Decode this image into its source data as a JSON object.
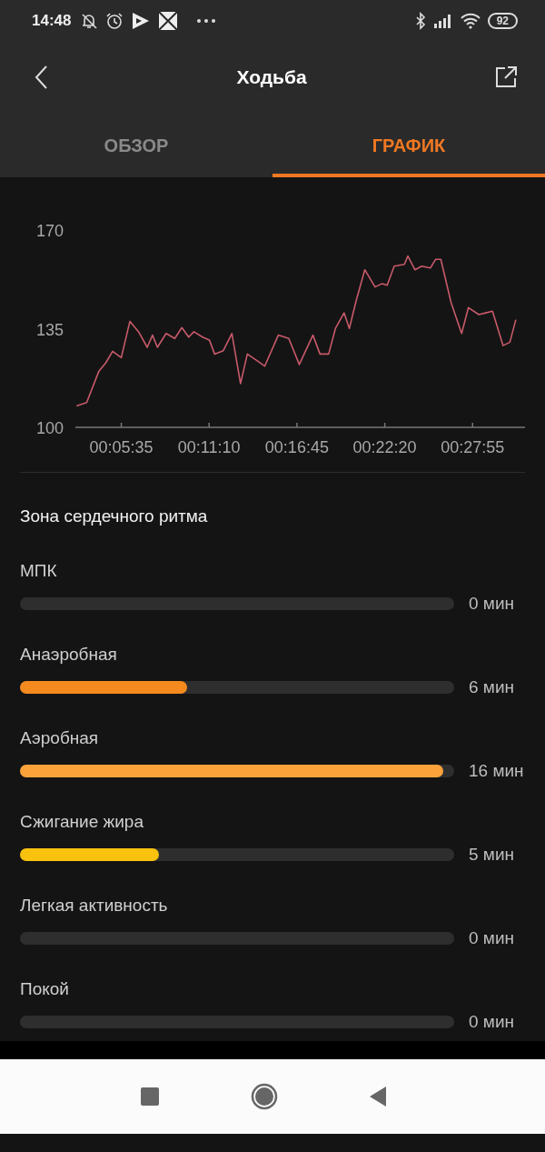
{
  "status_bar": {
    "time": "14:48",
    "battery": "92"
  },
  "header": {
    "title": "Ходьба"
  },
  "tabs": [
    {
      "label": "ОБЗОР",
      "selected": false
    },
    {
      "label": "ГРАФИК",
      "selected": true
    }
  ],
  "chart": {
    "chart_data": {
      "type": "line",
      "x": [
        164,
        203,
        249,
        276,
        302,
        335,
        368,
        401,
        434,
        454,
        473,
        506,
        539,
        566,
        592,
        612,
        645,
        671,
        691,
        724,
        757,
        790,
        816,
        855,
        882,
        934,
        974,
        1014,
        1066,
        1093,
        1126,
        1152,
        1185,
        1205,
        1231,
        1264,
        1303,
        1330,
        1349,
        1376,
        1415,
        1428,
        1455,
        1481,
        1514,
        1534,
        1554,
        1593,
        1633,
        1659,
        1699,
        1725,
        1751,
        1791,
        1817,
        1840
      ],
      "series": [
        {
          "color": "#c85a6a",
          "values": [
            107.6,
            108.8,
            119.8,
            122.9,
            127,
            124.7,
            137.6,
            133.9,
            128.4,
            132.7,
            128.4,
            133.3,
            131.5,
            135.4,
            132,
            133.9,
            132,
            131,
            126,
            127.2,
            133.3,
            115.5,
            126,
            123.5,
            121.7,
            132.7,
            131.5,
            122.3,
            132.7,
            126,
            126,
            135.1,
            140.6,
            135.1,
            144.9,
            155.9,
            149.8,
            151,
            150.4,
            157.2,
            157.8,
            160.8,
            155.9,
            157.2,
            156.5,
            159.6,
            159.6,
            144.3,
            133.3,
            142.5,
            140,
            140.6,
            141.2,
            129,
            130.2,
            138.2
          ]
        }
      ],
      "xlim": [
        160,
        1875
      ],
      "ylim": [
        100,
        170
      ],
      "yticks": [
        100,
        135,
        170
      ],
      "xticks": [
        {
          "value": 335,
          "label": "00:05:35"
        },
        {
          "value": 670,
          "label": "00:11:10"
        },
        {
          "value": 1005,
          "label": "00:16:45"
        },
        {
          "value": 1340,
          "label": "00:22:20"
        },
        {
          "value": 1675,
          "label": "00:27:55"
        }
      ]
    }
  },
  "heart_rate_zones": {
    "title": "Зона сердечного ритма",
    "zones": [
      {
        "name": "МПК",
        "level": 0,
        "value": "0 мин"
      },
      {
        "name": "Анаэробная",
        "level": 0.385,
        "color": "#f58a1f",
        "value": "6 мин"
      },
      {
        "name": "Аэробная",
        "level": 0.975,
        "color": "#fba33a",
        "value": "16 мин"
      },
      {
        "name": "Сжигание жира",
        "level": 0.32,
        "color": "#f8c20e",
        "value": "5 мин"
      },
      {
        "name": "Легкая активность",
        "level": 0,
        "value": "0 мин"
      },
      {
        "name": "Покой",
        "level": 0,
        "value": "0 мин"
      }
    ]
  }
}
